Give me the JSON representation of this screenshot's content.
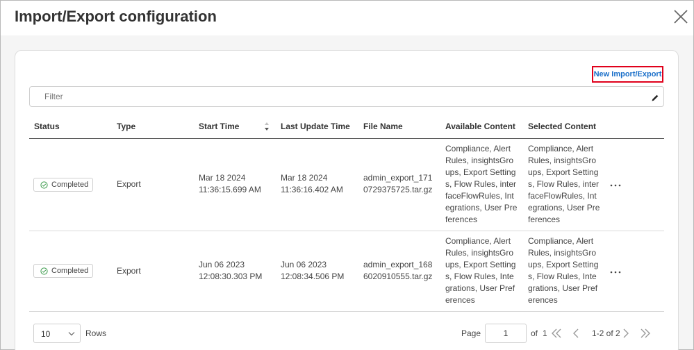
{
  "dialog": {
    "title": "Import/Export configuration"
  },
  "toolbar": {
    "new_label": "New Import/Export"
  },
  "filter": {
    "placeholder": "Filter",
    "value": ""
  },
  "table": {
    "columns": [
      "Status",
      "Type",
      "Start Time",
      "Last Update Time",
      "File Name",
      "Available Content",
      "Selected Content"
    ],
    "rows": [
      {
        "status": "Completed",
        "type": "Export",
        "start_time": "Mar 18 2024\n11:36:15.699 AM",
        "last_update": "Mar 18 2024\n11:36:16.402 AM",
        "file_name": "admin_export_1710729375725.tar.gz",
        "available_content": "Compliance, Alert Rules, insightsGroups, Export Settings, Flow Rules, interfaceFlowRules, Integrations, User Preferences",
        "selected_content": "Compliance, Alert Rules, insightsGroups, Export Settings, Flow Rules, interfaceFlowRules, Integrations, User Preferences"
      },
      {
        "status": "Completed",
        "type": "Export",
        "start_time": "Jun 06 2023\n12:08:30.303 PM",
        "last_update": "Jun 06 2023\n12:08:34.506 PM",
        "file_name": "admin_export_1686020910555.tar.gz",
        "available_content": "Compliance, Alert Rules, insightsGroups, Export Settings, Flow Rules, Integrations, User Preferences",
        "selected_content": "Compliance, Alert Rules, insightsGroups, Export Settings, Flow Rules, Integrations, User Preferences"
      }
    ]
  },
  "pagination": {
    "rows_per_page": "10",
    "rows_label": "Rows",
    "page_label": "Page",
    "page_value": "1",
    "of_label": "of",
    "total_pages": "1",
    "range": "1-2 of 2"
  },
  "colors": {
    "accent_link": "#1a6fc9",
    "highlight_border": "#e0001b",
    "success": "#3a9a4a"
  },
  "icons": [
    "close-icon",
    "edit-icon",
    "sort-icon",
    "check-circle-icon",
    "more-icon",
    "chevron-down-icon",
    "first-page-icon",
    "prev-page-icon",
    "next-page-icon",
    "last-page-icon"
  ]
}
